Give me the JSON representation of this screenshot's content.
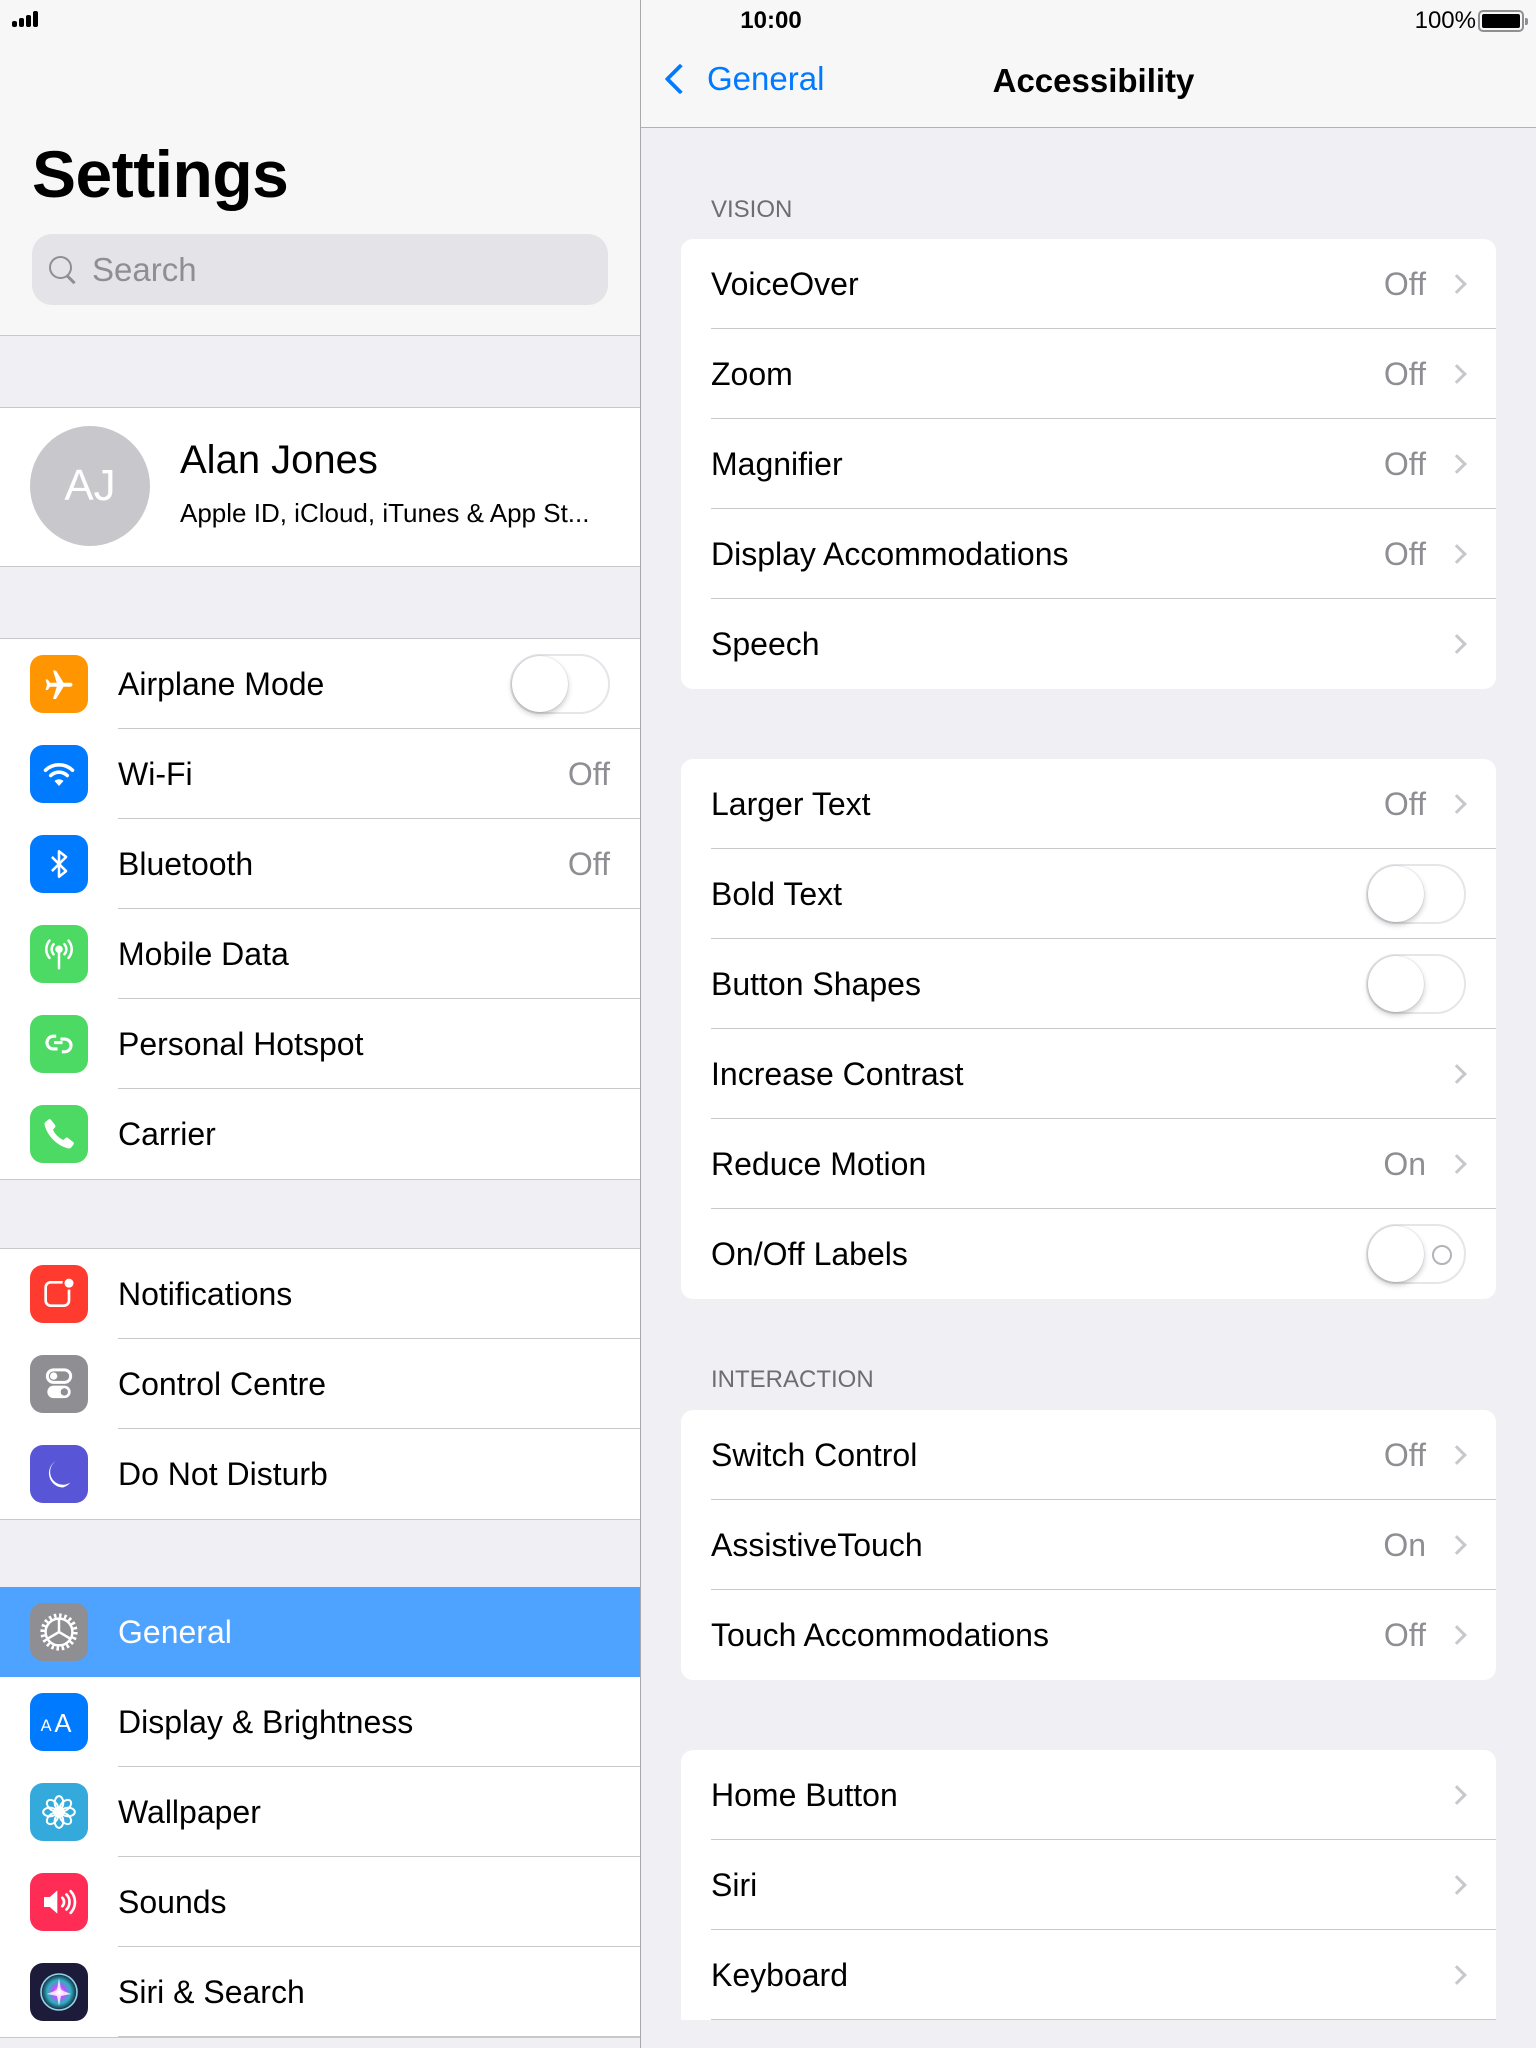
{
  "status_bar": {
    "time": "10:00",
    "battery_percent": "100%",
    "battery_level": 1.0
  },
  "left": {
    "title": "Settings",
    "search": {
      "placeholder": "Search",
      "value": ""
    },
    "profile": {
      "initials": "AJ",
      "name": "Alan Jones",
      "subtitle": "Apple ID, iCloud, iTunes & App St..."
    },
    "groups": [
      [
        {
          "id": "airplane-mode",
          "label": "Airplane Mode",
          "icon": "airplane-icon",
          "icon_bg": "#ff9500",
          "control": "toggle",
          "toggle_on": false
        },
        {
          "id": "wifi",
          "label": "Wi-Fi",
          "icon": "wifi-icon",
          "icon_bg": "#007aff",
          "value": "Off"
        },
        {
          "id": "bluetooth",
          "label": "Bluetooth",
          "icon": "bluetooth-icon",
          "icon_bg": "#007aff",
          "value": "Off"
        },
        {
          "id": "mobile-data",
          "label": "Mobile Data",
          "icon": "antenna-icon",
          "icon_bg": "#4cd964"
        },
        {
          "id": "personal-hotspot",
          "label": "Personal Hotspot",
          "icon": "hotspot-link-icon",
          "icon_bg": "#4cd964"
        },
        {
          "id": "carrier",
          "label": "Carrier",
          "icon": "phone-icon",
          "icon_bg": "#4cd964"
        }
      ],
      [
        {
          "id": "notifications",
          "label": "Notifications",
          "icon": "notifications-icon",
          "icon_bg": "#ff3b30"
        },
        {
          "id": "control-centre",
          "label": "Control Centre",
          "icon": "control-centre-icon",
          "icon_bg": "#8e8e93"
        },
        {
          "id": "do-not-disturb",
          "label": "Do Not Disturb",
          "icon": "moon-icon",
          "icon_bg": "#5856d6"
        }
      ],
      [
        {
          "id": "general",
          "label": "General",
          "icon": "gear-icon",
          "icon_bg": "#8e8e93",
          "selected": true
        },
        {
          "id": "display-brightness",
          "label": "Display & Brightness",
          "icon": "text-size-icon",
          "icon_bg": "#007aff"
        },
        {
          "id": "wallpaper",
          "label": "Wallpaper",
          "icon": "flower-icon",
          "icon_bg": "#34aadc"
        },
        {
          "id": "sounds",
          "label": "Sounds",
          "icon": "speaker-icon",
          "icon_bg": "#ff2d55"
        },
        {
          "id": "siri-search",
          "label": "Siri & Search",
          "icon": "siri-icon",
          "icon_bg": "#1c1c3a"
        }
      ]
    ]
  },
  "right": {
    "back_label": "General",
    "title": "Accessibility",
    "sections": [
      {
        "header": "VISION",
        "rows": [
          {
            "label": "VoiceOver",
            "value": "Off",
            "chevron": true
          },
          {
            "label": "Zoom",
            "value": "Off",
            "chevron": true
          },
          {
            "label": "Magnifier",
            "value": "Off",
            "chevron": true
          },
          {
            "label": "Display Accommodations",
            "value": "Off",
            "chevron": true
          },
          {
            "label": "Speech",
            "chevron": true
          }
        ]
      },
      {
        "header": "",
        "rows": [
          {
            "label": "Larger Text",
            "value": "Off",
            "chevron": true
          },
          {
            "label": "Bold Text",
            "control": "toggle",
            "toggle_on": false
          },
          {
            "label": "Button Shapes",
            "control": "toggle",
            "toggle_on": false
          },
          {
            "label": "Increase Contrast",
            "chevron": true
          },
          {
            "label": "Reduce Motion",
            "value": "On",
            "chevron": true
          },
          {
            "label": "On/Off Labels",
            "control": "toggle",
            "toggle_on": false,
            "show_label_ring": true
          }
        ]
      },
      {
        "header": "INTERACTION",
        "rows": [
          {
            "label": "Switch Control",
            "value": "Off",
            "chevron": true
          },
          {
            "label": "AssistiveTouch",
            "value": "On",
            "chevron": true
          },
          {
            "label": "Touch Accommodations",
            "value": "Off",
            "chevron": true
          }
        ]
      },
      {
        "header": "",
        "rows": [
          {
            "label": "Home Button",
            "chevron": true
          },
          {
            "label": "Siri",
            "chevron": true
          },
          {
            "label": "Keyboard",
            "chevron": true
          }
        ]
      }
    ]
  },
  "colors": {
    "accent": "#007aff",
    "selection": "#4da3ff",
    "group_bg": "#efeff4",
    "secondary_text": "#8e8e93"
  }
}
